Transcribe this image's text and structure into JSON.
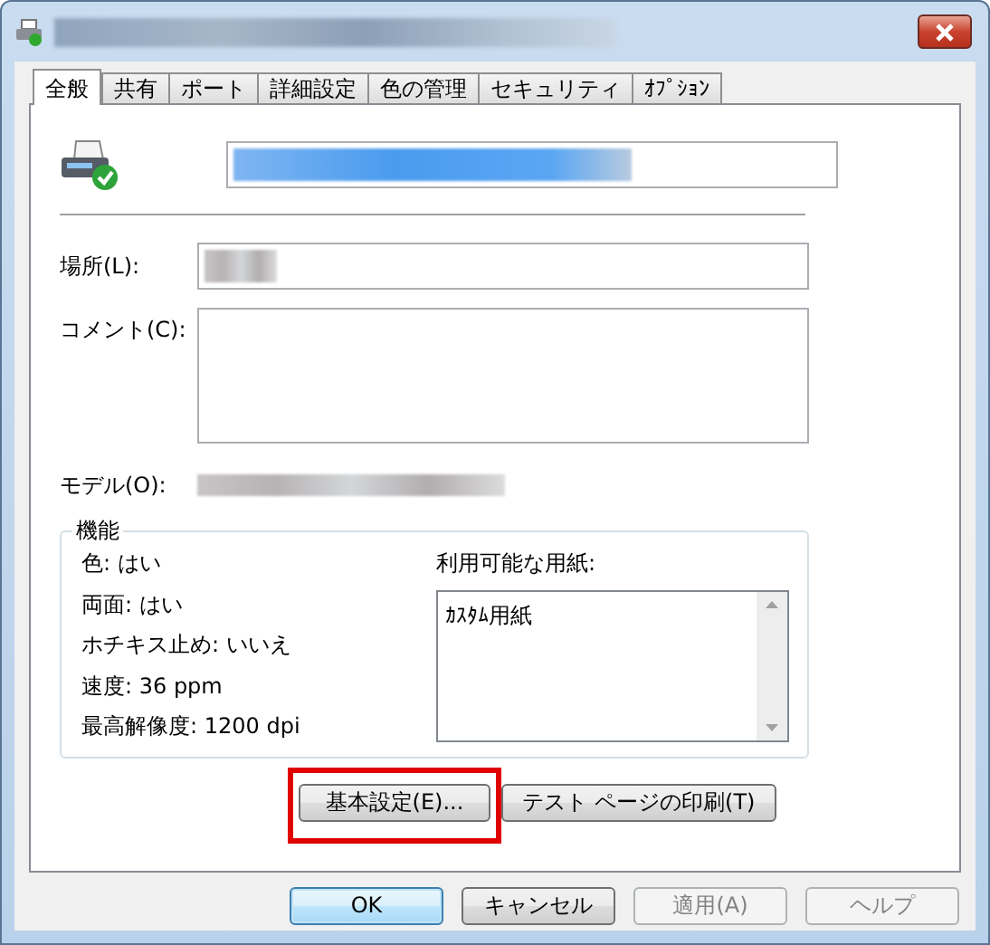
{
  "tabs": [
    {
      "label": "全般",
      "selected": true
    },
    {
      "label": "共有",
      "selected": false
    },
    {
      "label": "ポート",
      "selected": false
    },
    {
      "label": "詳細設定",
      "selected": false
    },
    {
      "label": "色の管理",
      "selected": false
    },
    {
      "label": "セキュリティ",
      "selected": false
    },
    {
      "label": "ｵﾌﾟｼｮﾝ",
      "selected": false
    }
  ],
  "location": {
    "label": "場所(L):"
  },
  "comment": {
    "label": "コメント(C):"
  },
  "model": {
    "label": "モデル(O):"
  },
  "features": {
    "legend": "機能",
    "items": [
      "色: はい",
      "両面: はい",
      "ホチキス止め: いいえ",
      "速度: 36 ppm",
      "最高解像度: 1200 dpi"
    ],
    "paper_label": "利用可能な用紙:",
    "papers": [
      "ｶｽﾀﾑ用紙"
    ]
  },
  "action_buttons": [
    {
      "label": "基本設定(E)...",
      "highlighted": true
    },
    {
      "label": "テスト ページの印刷(T)",
      "highlighted": false
    }
  ],
  "dialog_buttons": [
    {
      "label": "OK",
      "default": true,
      "disabled": false
    },
    {
      "label": "キャンセル",
      "default": false,
      "disabled": false
    },
    {
      "label": "適用(A)",
      "default": false,
      "disabled": true
    },
    {
      "label": "ヘルプ",
      "default": false,
      "disabled": true
    }
  ]
}
